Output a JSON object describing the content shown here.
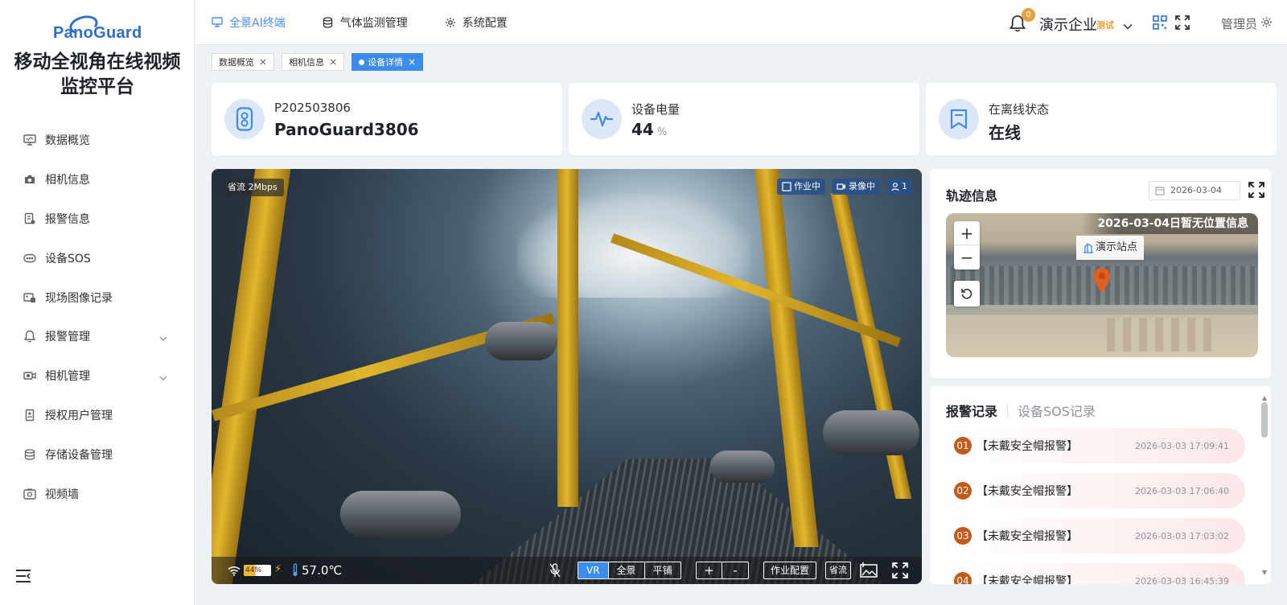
{
  "brand": {
    "logo_text": "PanoGuard",
    "platform_title_line1": "移动全视角在线视频",
    "platform_title_line2": "监控平台"
  },
  "sidebar": {
    "items": [
      {
        "label": "数据概览",
        "icon": "monitor-icon",
        "has_children": false
      },
      {
        "label": "相机信息",
        "icon": "camera-icon",
        "has_children": false
      },
      {
        "label": "报警信息",
        "icon": "alert-doc-icon",
        "has_children": false
      },
      {
        "label": "设备SOS",
        "icon": "sos-icon",
        "has_children": false
      },
      {
        "label": "现场图像记录",
        "icon": "image-record-icon",
        "has_children": false
      },
      {
        "label": "报警管理",
        "icon": "bell-icon",
        "has_children": true
      },
      {
        "label": "相机管理",
        "icon": "camera-manage-icon",
        "has_children": true
      },
      {
        "label": "授权用户管理",
        "icon": "user-doc-icon",
        "has_children": false
      },
      {
        "label": "存储设备管理",
        "icon": "database-icon",
        "has_children": false
      },
      {
        "label": "视频墙",
        "icon": "video-wall-icon",
        "has_children": false
      }
    ]
  },
  "header": {
    "nav": [
      {
        "label": "全景AI终端",
        "icon": "monitor-icon",
        "active": true
      },
      {
        "label": "气体监测管理",
        "icon": "database-icon",
        "active": false
      },
      {
        "label": "系统配置",
        "icon": "gear-icon",
        "active": false
      }
    ],
    "notification_count": "0",
    "company": "演示企业",
    "company_tag": "测试",
    "user": "管理员"
  },
  "tabs": [
    {
      "label": "数据概览",
      "active": false
    },
    {
      "label": "相机信息",
      "active": false
    },
    {
      "label": "设备详情",
      "active": true
    }
  ],
  "stats": {
    "device": {
      "id": "P202503806",
      "name": "PanoGuard3806"
    },
    "battery": {
      "label": "设备电量",
      "value": "44",
      "unit": "%"
    },
    "status": {
      "label": "在离线状态",
      "value": "在线"
    }
  },
  "video": {
    "stream_label": "省流 2Mbps",
    "badges": [
      "作业中",
      "录像中",
      "1"
    ],
    "battery_text": "44%",
    "battery_level": 0.44,
    "temperature": "57.0℃",
    "view_modes": [
      "VR",
      "全景",
      "平铺"
    ],
    "active_view_mode": "VR",
    "zoom_in": "+",
    "zoom_out": "-",
    "work_config": "作业配置",
    "save_stream": "省流"
  },
  "track": {
    "title": "轨迹信息",
    "date": "2026-03-04",
    "map_notice": "2026-03-04日暂无位置信息",
    "site_label": "演示站点",
    "zoom_in": "+",
    "zoom_out": "−"
  },
  "alarms": {
    "tabs": [
      "报警记录",
      "设备SOS记录"
    ],
    "active_tab": "报警记录",
    "records": [
      {
        "num": "01",
        "text": "【未戴安全帽报警】",
        "time": "2026-03-03 17:09:41"
      },
      {
        "num": "02",
        "text": "【未戴安全帽报警】",
        "time": "2026-03-03 17:06:40"
      },
      {
        "num": "03",
        "text": "【未戴安全帽报警】",
        "time": "2026-03-03 17:03:02"
      },
      {
        "num": "04",
        "text": "【未戴安全帽报警】",
        "time": "2026-03-03 16:45:39"
      }
    ]
  },
  "colors": {
    "accent": "#3d8bea",
    "badge_orange": "#e6a23c",
    "alarm_num": "#c25a1c"
  }
}
